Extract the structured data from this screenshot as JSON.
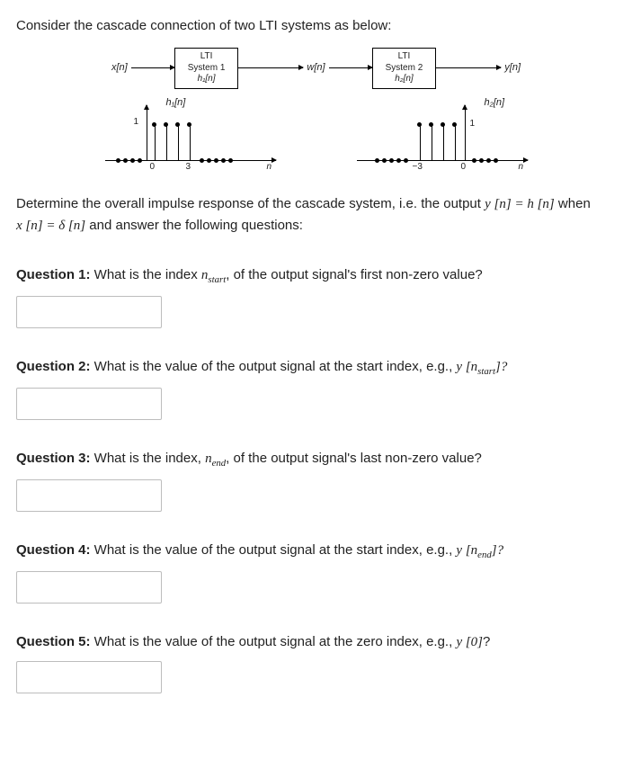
{
  "intro": "Consider the cascade connection of two LTI systems as below:",
  "signals": {
    "x": "x[n]",
    "w": "w[n]",
    "y": "y[n]"
  },
  "box1": {
    "l1": "LTI",
    "l2": "System 1",
    "l3": "h₁[n]"
  },
  "box2": {
    "l1": "LTI",
    "l2": "System 2",
    "l3": "h₂[n]"
  },
  "plot1": {
    "title": "h₁[n]",
    "ylabel": "1",
    "tick_a": "0",
    "tick_b": "3",
    "endlabel": "n"
  },
  "plot2": {
    "title": "h₂[n]",
    "ylabel": "1",
    "tick_a": "−3",
    "tick_b": "0",
    "endlabel": "n"
  },
  "explain_line1": "Determine the overall impulse response of the cascade system, i.e. the output ",
  "explain_mid1": "y [n] = h [n]",
  "explain_line1b": " when ",
  "explain_line2a": "x [n] = δ [n]",
  "explain_line2b": " and answer the following questions:",
  "q1": {
    "label": "Question 1:",
    "text": " What is the index ",
    "sym": "n",
    "sub": "start",
    "text2": ", of the output signal's first non-zero value?"
  },
  "q2": {
    "label": "Question 2:",
    "text": " What is the value of the output signal at the start index, e.g., ",
    "sym": "y [n",
    "sub": "start",
    "text2": "]?"
  },
  "q3": {
    "label": "Question 3:",
    "text": " What is the index, ",
    "sym": "n",
    "sub": "end",
    "text2": ", of the output signal's last non-zero value?"
  },
  "q4": {
    "label": "Question 4:",
    "text": " What is the value of the output signal at the start index, e.g., ",
    "sym": "y [n",
    "sub": "end",
    "text2": "]?"
  },
  "q5": {
    "label": "Question 5:",
    "text": " What is the value of the output signal at the zero index, e.g., ",
    "sym": "y [0]",
    "text2": "?"
  },
  "chart_data": [
    {
      "type": "bar",
      "name": "h1[n]",
      "x": [
        0,
        1,
        2,
        3
      ],
      "values": [
        1,
        1,
        1,
        1
      ],
      "ylim": [
        0,
        1
      ],
      "xlabel": "n",
      "ylabel": ""
    },
    {
      "type": "bar",
      "name": "h2[n]",
      "x": [
        -3,
        -2,
        -1,
        0
      ],
      "values": [
        1,
        1,
        1,
        1
      ],
      "ylim": [
        0,
        1
      ],
      "xlabel": "n",
      "ylabel": ""
    }
  ]
}
